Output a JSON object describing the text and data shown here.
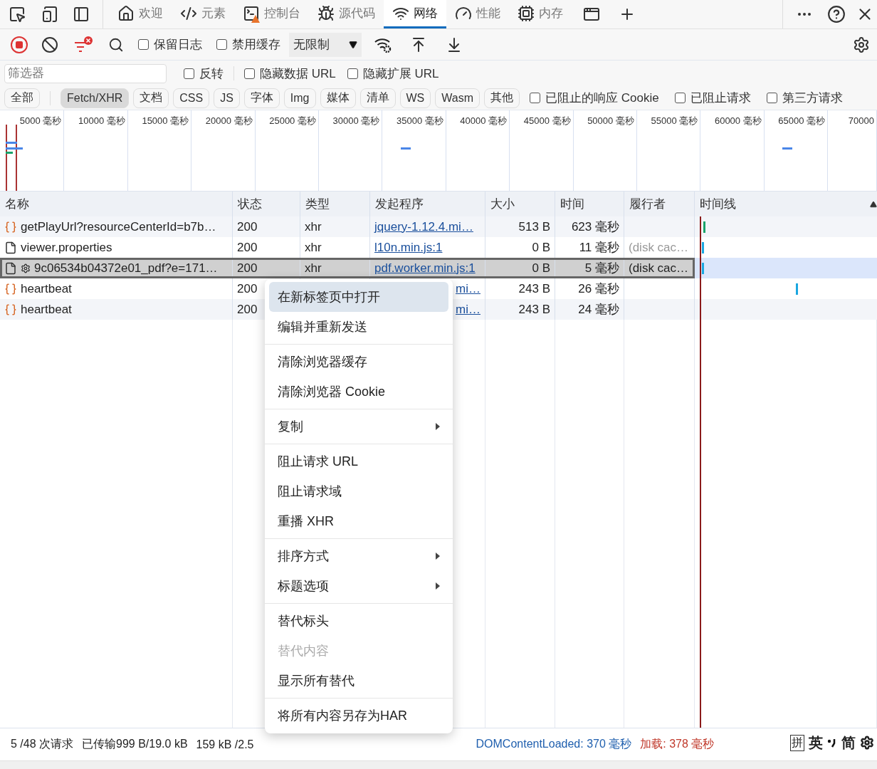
{
  "devtools_tabs": [
    {
      "label": "欢迎",
      "selected": false,
      "warning": false
    },
    {
      "label": "元素",
      "selected": false,
      "warning": false
    },
    {
      "label": "控制台",
      "selected": false,
      "warning": true
    },
    {
      "label": "源代码",
      "selected": false,
      "warning": false
    },
    {
      "label": "网络",
      "selected": true,
      "warning": false
    },
    {
      "label": "性能",
      "selected": false,
      "warning": false
    },
    {
      "label": "内存",
      "selected": false,
      "warning": false
    }
  ],
  "toolbar": {
    "recording": true,
    "checks": [
      {
        "label": "保留日志",
        "checked": false
      },
      {
        "label": "禁用缓存",
        "checked": false
      }
    ],
    "throttling": "无限制"
  },
  "filter": {
    "placeholder": "筛选器",
    "options": [
      {
        "label": "反转",
        "checked": false
      },
      {
        "label": "隐藏数据 URL",
        "checked": false
      },
      {
        "label": "隐藏扩展 URL",
        "checked": false
      }
    ]
  },
  "type_filters": [
    {
      "label": "全部",
      "selected": false
    },
    {
      "label": "Fetch/XHR",
      "selected": true
    },
    {
      "label": "文档",
      "selected": false
    },
    {
      "label": "CSS",
      "selected": false
    },
    {
      "label": "JS",
      "selected": false
    },
    {
      "label": "字体",
      "selected": false
    },
    {
      "label": "Img",
      "selected": false
    },
    {
      "label": "媒体",
      "selected": false
    },
    {
      "label": "清单",
      "selected": false
    },
    {
      "label": "WS",
      "selected": false
    },
    {
      "label": "Wasm",
      "selected": false
    },
    {
      "label": "其他",
      "selected": false
    }
  ],
  "extra_filters": [
    {
      "label": "已阻止的响应 Cookie",
      "checked": false
    },
    {
      "label": "已阻止请求",
      "checked": false
    },
    {
      "label": "第三方请求",
      "checked": false
    }
  ],
  "overview": {
    "ticks": [
      "5000 毫秒",
      "10000 毫秒",
      "15000 毫秒",
      "20000 毫秒",
      "25000 毫秒",
      "30000 毫秒",
      "35000 毫秒",
      "40000 毫秒",
      "45000 毫秒",
      "50000 毫秒",
      "55000 毫秒",
      "60000 毫秒",
      "65000 毫秒",
      "70000"
    ]
  },
  "table": {
    "columns": [
      "名称",
      "状态",
      "类型",
      "发起程序",
      "大小",
      "时间",
      "履行者",
      "时间线"
    ],
    "rows": [
      {
        "kind": "xhr",
        "name": "getPlayUrl?resourceCenterId=b7b…",
        "status": "200",
        "type": "xhr",
        "initiator": "jquery-1.12.4.mi…",
        "size": "513 B",
        "time": "623 毫秒",
        "selected": false,
        "covered": false,
        "gear": false
      },
      {
        "kind": "doc",
        "gear": false,
        "name": "viewer.properties",
        "status": "200",
        "type": "xhr",
        "initiator": "l10n.min.js:1",
        "size": "0 B",
        "time": "11 毫秒",
        "fulfiller": "(disk cac…",
        "selected": false,
        "covered": false
      },
      {
        "kind": "doc",
        "gear": true,
        "name": "9c06534b04372e01_pdf?e=171…",
        "status": "200",
        "type": "xhr",
        "initiator": "pdf.worker.min.js:1",
        "size": "0 B",
        "time": "5 毫秒",
        "fulfiller": "(disk cac…",
        "selected": true,
        "covered": false
      },
      {
        "kind": "xhr",
        "name": "heartbeat",
        "status": "200",
        "initiator": "mi…",
        "size": "243 B",
        "time": "26 毫秒",
        "selected": false,
        "covered": true,
        "gear": false
      },
      {
        "kind": "xhr",
        "name": "heartbeat",
        "status": "200",
        "initiator": "mi…",
        "size": "243 B",
        "time": "24 毫秒",
        "selected": false,
        "covered": true,
        "gear": false
      }
    ]
  },
  "context_menu": [
    {
      "kind": "item",
      "label": "在新标签页中打开",
      "hovered": true,
      "submenu": false,
      "disabled": false
    },
    {
      "kind": "item",
      "label": "编辑并重新发送",
      "hovered": false,
      "submenu": false,
      "disabled": false
    },
    {
      "kind": "separator"
    },
    {
      "kind": "item",
      "label": "清除浏览器缓存",
      "hovered": false,
      "submenu": false,
      "disabled": false
    },
    {
      "kind": "item",
      "label": "清除浏览器 Cookie",
      "hovered": false,
      "submenu": false,
      "disabled": false
    },
    {
      "kind": "separator"
    },
    {
      "kind": "item",
      "label": "复制",
      "hovered": false,
      "submenu": true,
      "disabled": false
    },
    {
      "kind": "separator"
    },
    {
      "kind": "item",
      "label": "阻止请求 URL",
      "hovered": false,
      "submenu": false,
      "disabled": false
    },
    {
      "kind": "item",
      "label": "阻止请求域",
      "hovered": false,
      "submenu": false,
      "disabled": false
    },
    {
      "kind": "item",
      "label": "重播 XHR",
      "hovered": false,
      "submenu": false,
      "disabled": false
    },
    {
      "kind": "separator"
    },
    {
      "kind": "item",
      "label": "排序方式",
      "hovered": false,
      "submenu": true,
      "disabled": false
    },
    {
      "kind": "item",
      "label": "标题选项",
      "hovered": false,
      "submenu": true,
      "disabled": false
    },
    {
      "kind": "separator"
    },
    {
      "kind": "item",
      "label": "替代标头",
      "hovered": false,
      "submenu": false,
      "disabled": false
    },
    {
      "kind": "item",
      "label": "替代内容",
      "hovered": false,
      "submenu": false,
      "disabled": true
    },
    {
      "kind": "item",
      "label": "显示所有替代",
      "hovered": false,
      "submenu": false,
      "disabled": false
    },
    {
      "kind": "separator"
    },
    {
      "kind": "item",
      "label": "将所有内容另存为HAR",
      "hovered": false,
      "submenu": false,
      "disabled": false
    }
  ],
  "status_bar": [
    {
      "kind": "plain",
      "text": "5 /48 次请求"
    },
    {
      "kind": "plain",
      "text": "已传输999 B/19.0 kB"
    },
    {
      "kind": "plain",
      "text": "159 kB /2.5"
    },
    {
      "kind": "dom",
      "text": "DOMContentLoaded: 370 毫秒"
    },
    {
      "kind": "load",
      "text": "加载: 378 毫秒"
    }
  ],
  "ime": [
    "拼",
    "英",
    "简"
  ]
}
